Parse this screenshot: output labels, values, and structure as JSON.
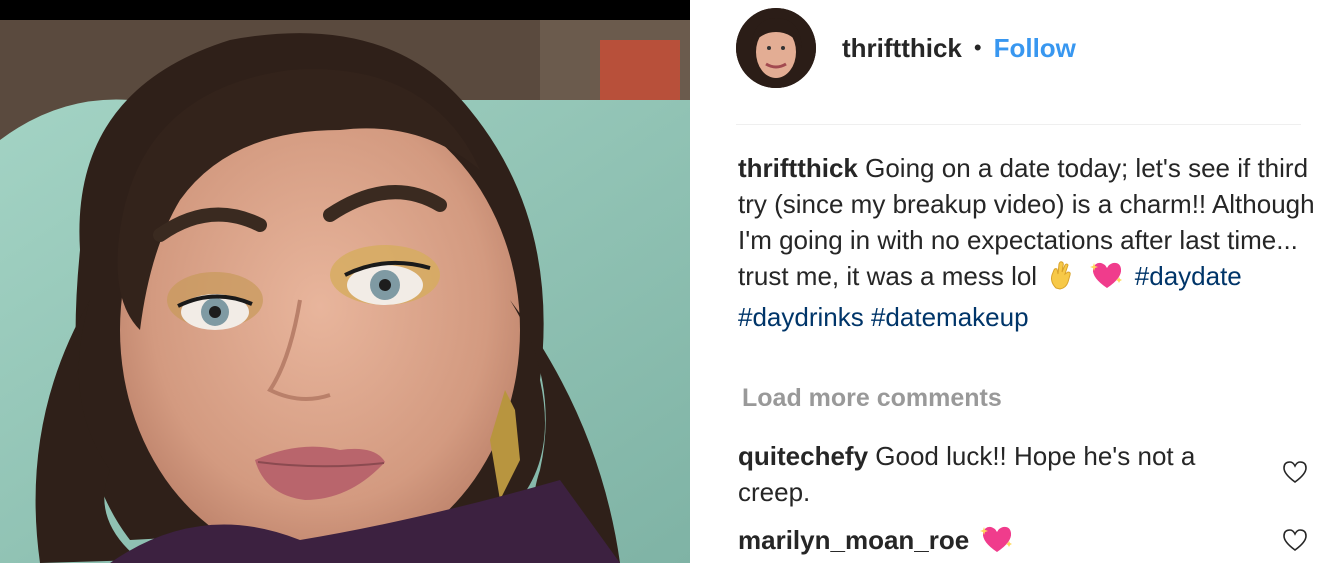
{
  "post": {
    "author": "thriftthick",
    "separator": "•",
    "follow_label": "Follow"
  },
  "caption": {
    "author": "thriftthick",
    "text": "Going on a date today; let's see if third try (since my breakup video) is a charm!! Although I'm going in with no expectations after last time... trust me, it was a mess lol",
    "emojis": [
      "crossed-fingers-icon",
      "sparkling-heart-icon"
    ],
    "hashtags": [
      "#daydate",
      "#daydrinks",
      "#datemakeup"
    ]
  },
  "load_more_label": "Load more comments",
  "comments": [
    {
      "user": "quitechefy",
      "text": "Good luck!! Hope he's not a creep."
    },
    {
      "user": "marilyn_moan_roe",
      "text": "",
      "emoji": "sparkling-heart-icon"
    }
  ],
  "colors": {
    "link_blue": "#3897f0",
    "hashtag": "#003569",
    "muted": "#999999",
    "text": "#262626"
  }
}
